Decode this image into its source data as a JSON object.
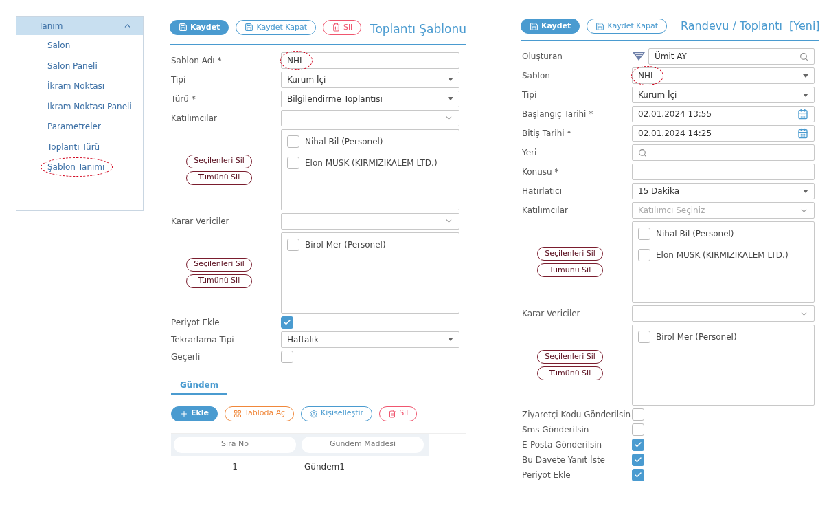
{
  "sidebar": {
    "header": {
      "label": "Tanım",
      "expanded": true
    },
    "items": [
      {
        "label": "Salon"
      },
      {
        "label": "Salon Paneli"
      },
      {
        "label": "İkram Noktası"
      },
      {
        "label": "İkram Noktası Paneli"
      },
      {
        "label": "Parametreler"
      },
      {
        "label": "Toplantı Türü"
      },
      {
        "label": "Şablon Tanımı",
        "annotated": true
      }
    ]
  },
  "template_form": {
    "toolbar": [
      {
        "kind": "primary",
        "label": "Kaydet"
      },
      {
        "kind": "outline",
        "label": "Kaydet Kapat"
      },
      {
        "kind": "danger",
        "label": "Sil"
      }
    ],
    "title": "Toplantı Şablonu",
    "fields": [
      {
        "kind": "text",
        "label": "Şablon Adı *",
        "value": "NHL",
        "annotated": true
      },
      {
        "kind": "select",
        "label": "Tipi",
        "value": "Kurum İçi"
      },
      {
        "kind": "select",
        "label": "Türü *",
        "value": "Bilgilendirme Toplantısı"
      },
      {
        "kind": "multiselect",
        "label": "Katılımcılar",
        "items": [
          {
            "label": "Nihal Bil (Personel)",
            "checked": false
          },
          {
            "label": "Elon MUSK (KIRMIZIKALEM LTD.)",
            "checked": false
          }
        ],
        "actions": [
          "Seçilenleri Sil",
          "Tümünü Sil"
        ]
      },
      {
        "kind": "multiselect",
        "label": "Karar Vericiler",
        "items": [
          {
            "label": "Birol Mer (Personel)",
            "checked": false
          }
        ],
        "actions": [
          "Seçilenleri Sil",
          "Tümünü Sil"
        ]
      },
      {
        "kind": "checkbox",
        "label": "Periyot Ekle",
        "checked": true
      },
      {
        "kind": "select",
        "label": "Tekrarlama Tipi",
        "value": "Haftalık"
      },
      {
        "kind": "checkbox",
        "label": "Geçerli",
        "checked": false
      }
    ],
    "tabs": [
      {
        "label": "Gündem",
        "selected": true
      }
    ],
    "agenda_toolbar": [
      {
        "kind": "primary",
        "label": "Ekle"
      },
      {
        "kind": "warning",
        "label": "Tabloda Aç"
      },
      {
        "kind": "outline",
        "label": "Kişiselleştir"
      },
      {
        "kind": "danger",
        "label": "Sil"
      }
    ],
    "table": {
      "columns": [
        "Sıra No",
        "Gündem Maddesi"
      ],
      "rows": [
        [
          "1",
          "Gündem1"
        ]
      ]
    }
  },
  "appointment_form": {
    "toolbar": [
      {
        "kind": "primary",
        "label": "Kaydet"
      },
      {
        "kind": "outline",
        "label": "Kaydet Kapat"
      }
    ],
    "title": "Randevu / Toplantı",
    "status": "[Yeni]",
    "fields": [
      {
        "kind": "user_lookup",
        "label": "Oluşturan",
        "value": "Ümit  AY"
      },
      {
        "kind": "select",
        "label": "Şablon",
        "value": "NHL",
        "annotated": true
      },
      {
        "kind": "select",
        "label": "Tipi",
        "value": "Kurum İçi"
      },
      {
        "kind": "date",
        "label": "Başlangıç Tarihi *",
        "value": "02.01.2024 13:55"
      },
      {
        "kind": "date",
        "label": "Bitiş Tarihi *",
        "value": "02.01.2024 14:25"
      },
      {
        "kind": "lookup",
        "label": "Yeri"
      },
      {
        "kind": "text",
        "label": "Konusu *"
      },
      {
        "kind": "select",
        "label": "Hatırlatıcı",
        "value": "15 Dakika"
      },
      {
        "kind": "multiselect",
        "label": "Katılımcılar",
        "placeholder": "Katılımcı Seçiniz",
        "items": [
          {
            "label": "Nihal Bil (Personel)",
            "checked": false
          },
          {
            "label": "Elon MUSK (KIRMIZIKALEM LTD.)",
            "checked": false
          }
        ],
        "actions": [
          "Seçilenleri Sil",
          "Tümünü Sil"
        ]
      },
      {
        "kind": "multiselect",
        "label": "Karar Vericiler",
        "items": [
          {
            "label": "Birol Mer (Personel)",
            "checked": false
          }
        ],
        "actions": [
          "Seçilenleri Sil",
          "Tümünü Sil"
        ]
      },
      {
        "kind": "checkbox",
        "label": "Ziyaretçi Kodu Gönderilsin",
        "checked": false
      },
      {
        "kind": "checkbox",
        "label": "Sms Gönderilsin",
        "checked": false
      },
      {
        "kind": "checkbox",
        "label": "E-Posta Gönderilsin",
        "checked": true
      },
      {
        "kind": "checkbox",
        "label": "Bu Davete Yanıt İste",
        "checked": true
      },
      {
        "kind": "checkbox",
        "label": "Periyot Ekle",
        "checked": true
      }
    ]
  }
}
